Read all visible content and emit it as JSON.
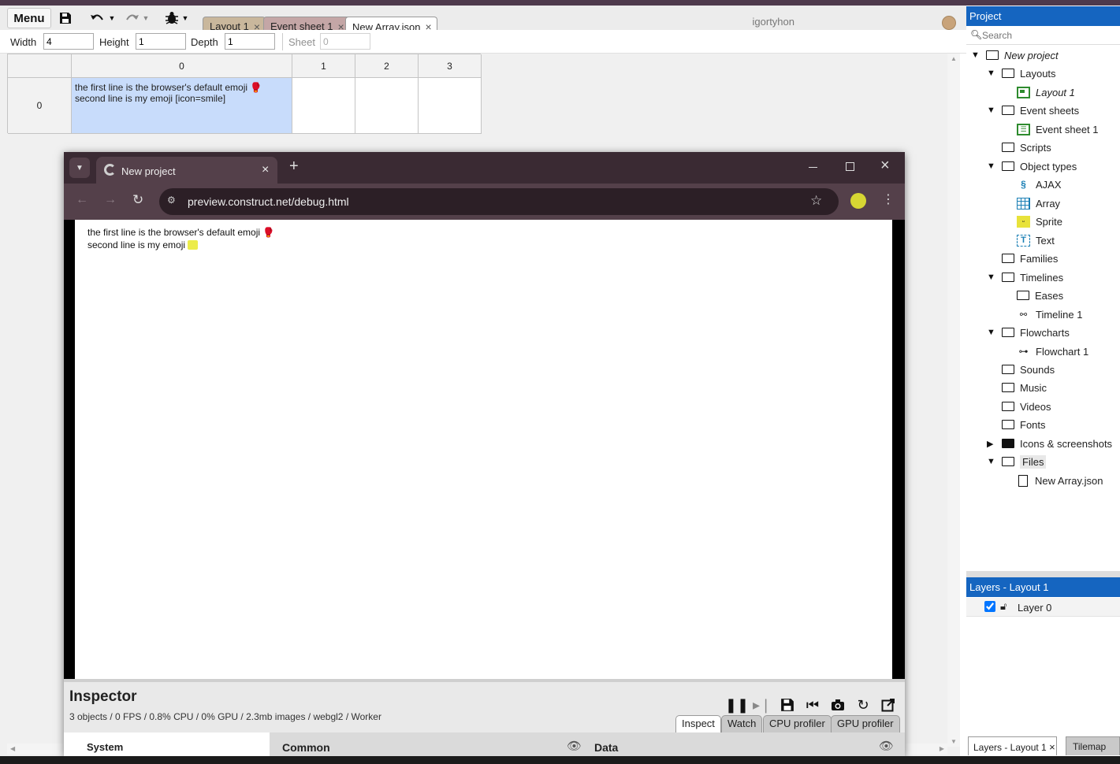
{
  "toolbar": {
    "menu_label": "Menu",
    "tabs": [
      {
        "label": "Layout 1",
        "color": "#c9b79c"
      },
      {
        "label": "Event sheet 1",
        "color": "#c4a6a6"
      },
      {
        "label": "New Array.json",
        "color": "#ffffff"
      }
    ],
    "tab_close": "×",
    "username": "igortyhon"
  },
  "properties": {
    "width_label": "Width",
    "width_value": "4",
    "height_label": "Height",
    "height_value": "1",
    "depth_label": "Depth",
    "depth_value": "1",
    "sheet_label": "Sheet",
    "sheet_value": "0"
  },
  "array_grid": {
    "column_headers": [
      "0",
      "1",
      "2",
      "3"
    ],
    "row_headers": [
      "0"
    ],
    "cell_0_line1": "the first line is the browser's default emoji 🥊",
    "cell_0_line2": "second line is my emoji [icon=smile]",
    "selected_color": "#c8dcfb"
  },
  "browser": {
    "tab_title": "New project",
    "url": "preview.construct.net/debug.html",
    "close": "×",
    "new_tab": "+",
    "game_line1": "the first line is the browser's default emoji 🥊",
    "game_line2": "second line is my emoji"
  },
  "inspector": {
    "title": "Inspector",
    "stats": "3 objects / 0 FPS / 0.8% CPU / 0% GPU / 2.3mb images / webgl2 / Worker",
    "tabs": [
      "Inspect",
      "Watch",
      "CPU profiler",
      "GPU profiler"
    ],
    "section_system": "System",
    "section_common": "Common",
    "section_data": "Data"
  },
  "project_panel": {
    "title": "Project",
    "search_placeholder": "Search",
    "items": [
      {
        "label": "New project"
      },
      {
        "label": "Layouts"
      },
      {
        "label": "Layout 1"
      },
      {
        "label": "Event sheets"
      },
      {
        "label": "Event sheet 1"
      },
      {
        "label": "Scripts"
      },
      {
        "label": "Object types"
      },
      {
        "label": "AJAX"
      },
      {
        "label": "Array"
      },
      {
        "label": "Sprite"
      },
      {
        "label": "Text"
      },
      {
        "label": "Families"
      },
      {
        "label": "Timelines"
      },
      {
        "label": "Eases"
      },
      {
        "label": "Timeline 1"
      },
      {
        "label": "Flowcharts"
      },
      {
        "label": "Flowchart 1"
      },
      {
        "label": "Sounds"
      },
      {
        "label": "Music"
      },
      {
        "label": "Videos"
      },
      {
        "label": "Fonts"
      },
      {
        "label": "Icons & screenshots"
      },
      {
        "label": "Files"
      },
      {
        "label": "New Array.json"
      }
    ]
  },
  "layers_panel": {
    "title": "Layers - Layout 1",
    "layer_name": "Layer 0",
    "bottom_tabs": [
      "Layers - Layout 1",
      "Tilemap"
    ]
  },
  "colors": {
    "accent": "#1565c0",
    "browser_frame": "#3a2a33"
  }
}
